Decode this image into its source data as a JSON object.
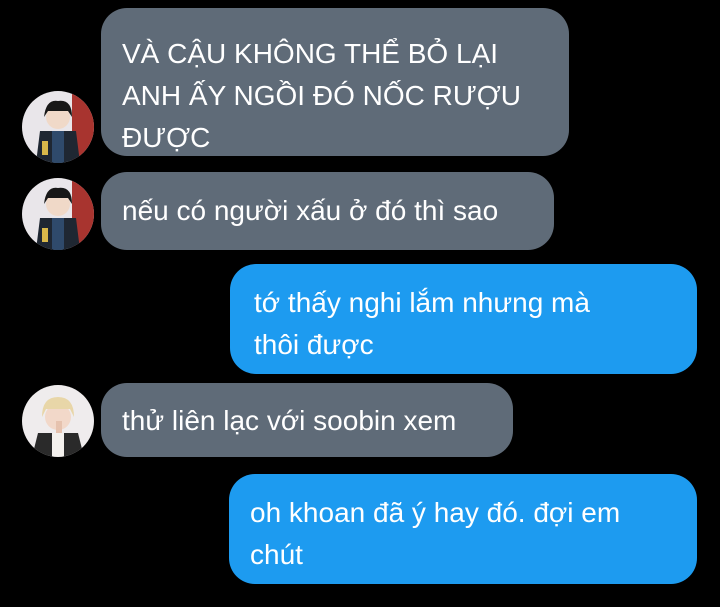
{
  "conversation": {
    "messages": [
      {
        "direction": "received",
        "sender_avatar": "avatar-dark-outfit",
        "text": "VÀ CẬU KHÔNG THỂ BỎ LẠI\nANH ẤY NGỒI ĐÓ NỐC RƯỢU\nĐƯỢC"
      },
      {
        "direction": "received",
        "sender_avatar": "avatar-dark-outfit",
        "text": "nếu có người xấu ở đó thì sao"
      },
      {
        "direction": "sent",
        "text": "tớ thấy nghi lắm nhưng mà\nthôi được"
      },
      {
        "direction": "received",
        "sender_avatar": "avatar-blond",
        "text": "thử liên lạc với soobin xem"
      },
      {
        "direction": "sent",
        "text": "oh khoan đã ý hay đó. đợi em\nchút"
      }
    ]
  },
  "colors": {
    "background": "#000000",
    "received_bubble": "#5f6b78",
    "sent_bubble": "#1d9bf0",
    "text": "#ffffff"
  }
}
